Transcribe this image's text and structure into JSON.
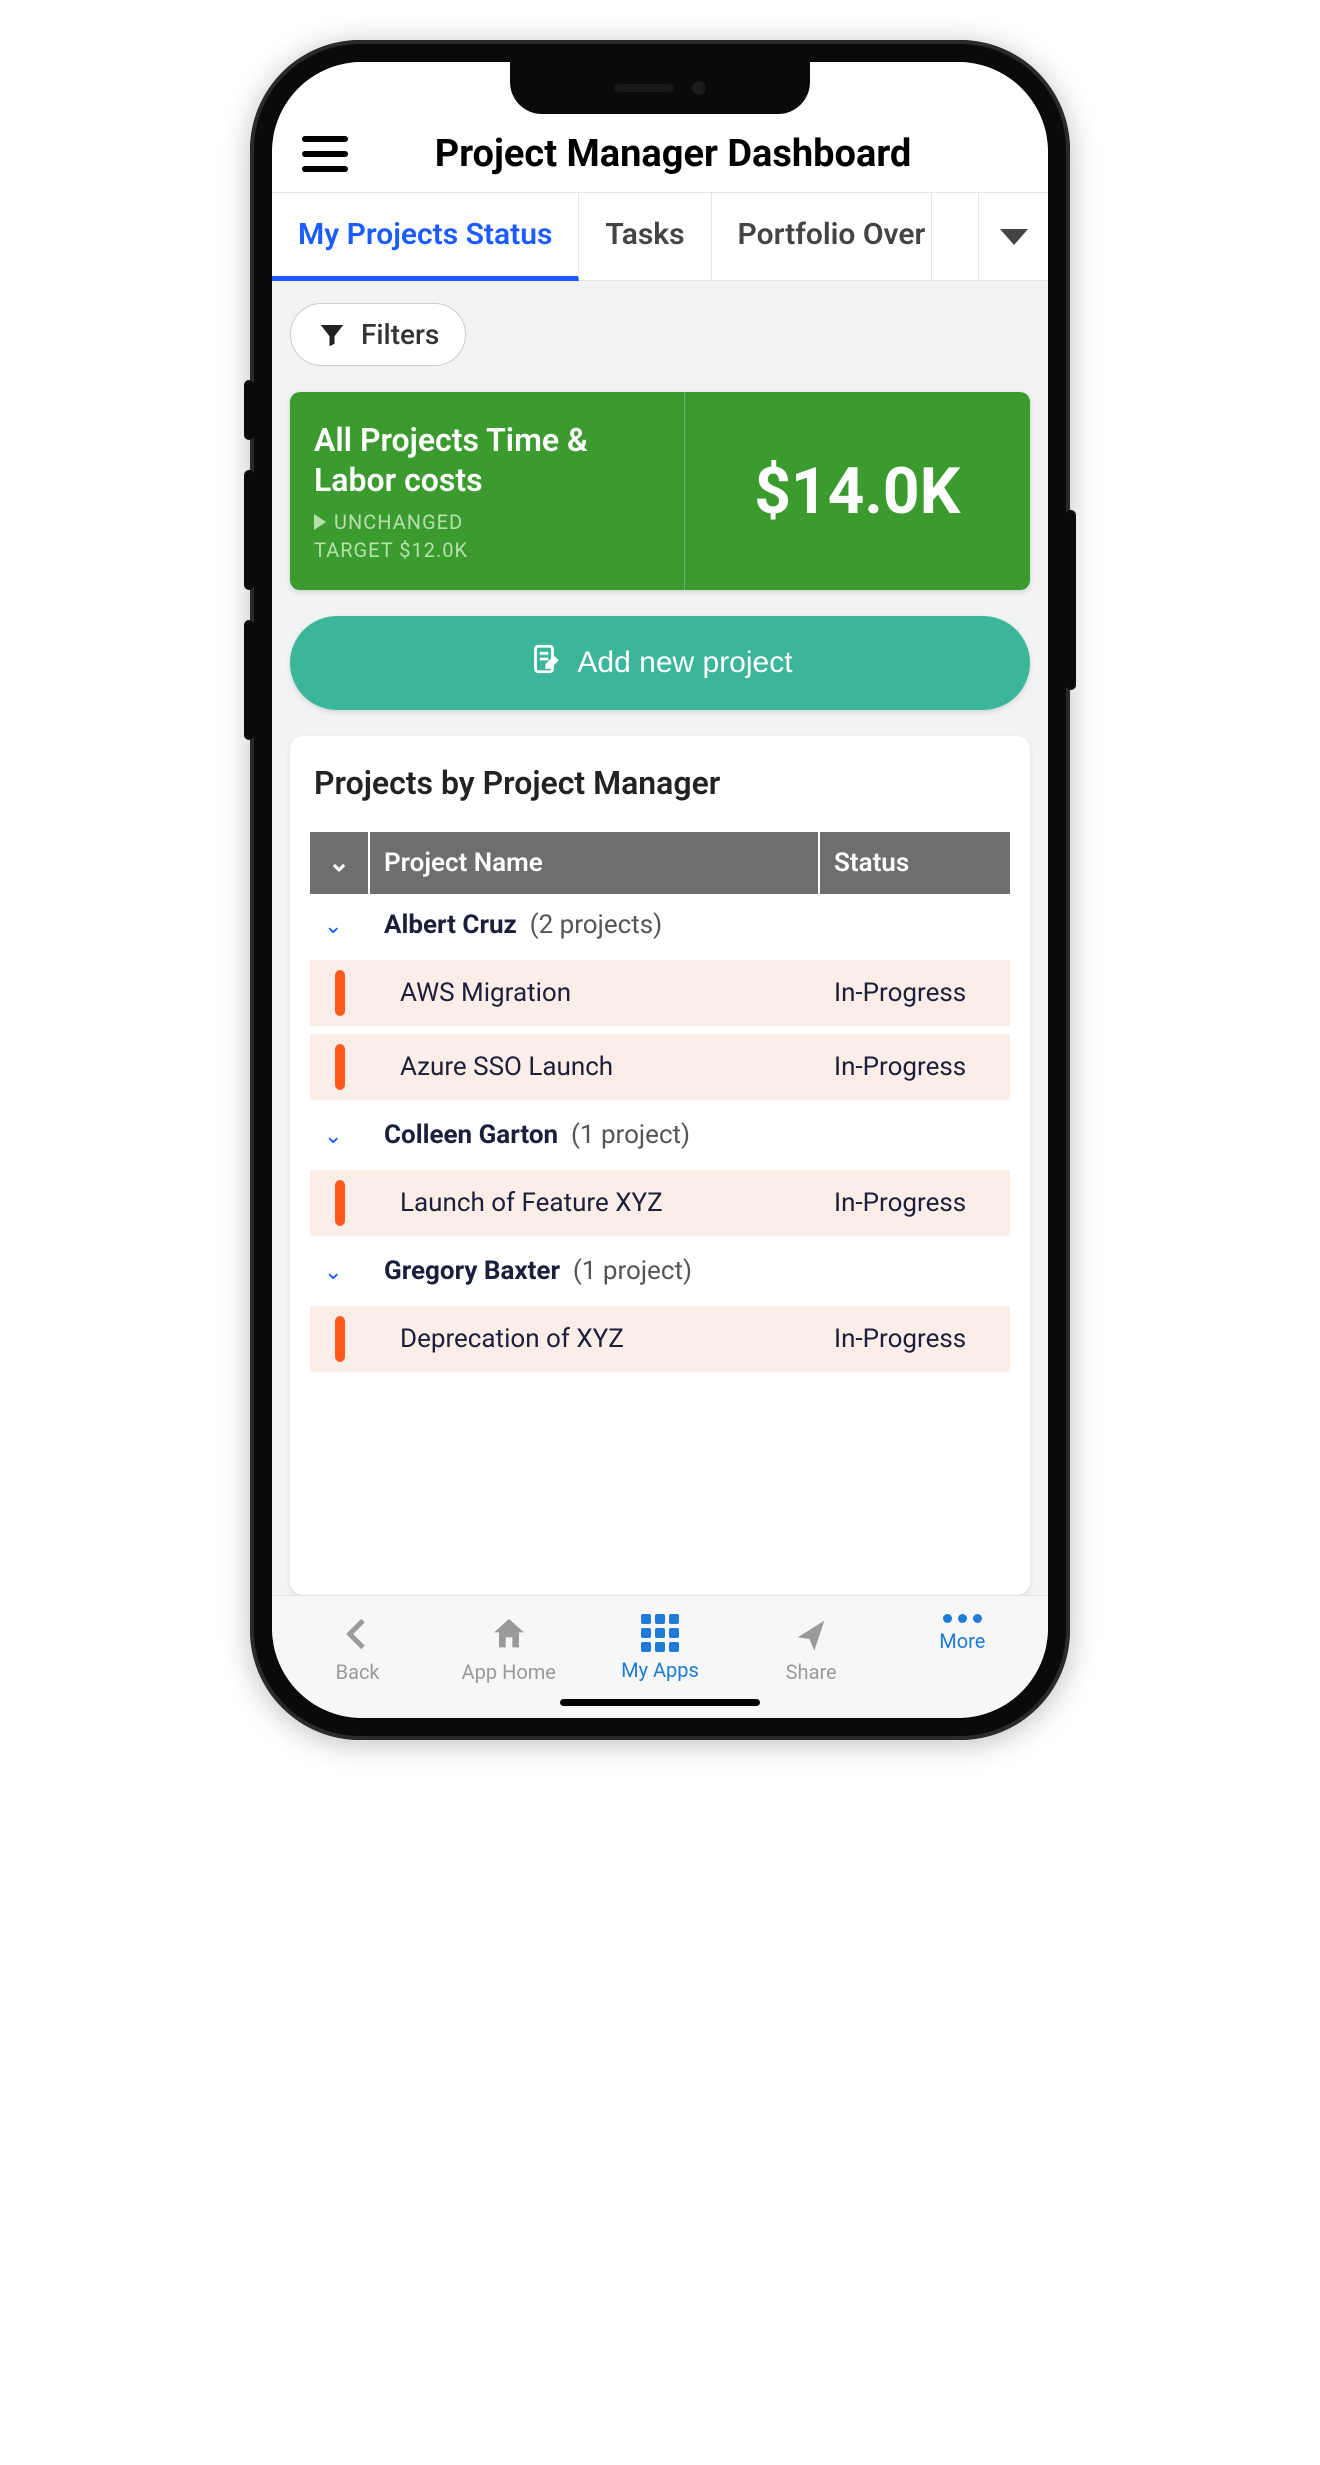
{
  "header": {
    "title": "Project Manager Dashboard"
  },
  "tabs": {
    "items": [
      "My Projects Status",
      "Tasks",
      "Portfolio Over"
    ],
    "active_index": 0
  },
  "filters": {
    "label": "Filters"
  },
  "kpi": {
    "title": "All Projects Time & Labor costs",
    "change_label": "UNCHANGED",
    "target_label": "TARGET $12.0K",
    "value": "$14.0K"
  },
  "add_project": {
    "label": "Add new project"
  },
  "projects_panel": {
    "title": "Projects by Project Manager",
    "columns": {
      "name": "Project Name",
      "status": "Status"
    },
    "groups": [
      {
        "manager": "Albert Cruz",
        "count_label": "(2 projects)",
        "rows": [
          {
            "name": "AWS Migration",
            "status": "In-Progress"
          },
          {
            "name": "Azure SSO Launch",
            "status": "In-Progress"
          }
        ]
      },
      {
        "manager": "Colleen Garton",
        "count_label": "(1 project)",
        "rows": [
          {
            "name": "Launch of Feature XYZ",
            "status": "In-Progress"
          }
        ]
      },
      {
        "manager": "Gregory Baxter",
        "count_label": "(1 project)",
        "rows": [
          {
            "name": "Deprecation of XYZ",
            "status": "In-Progress"
          }
        ]
      }
    ]
  },
  "bottom_nav": {
    "items": [
      {
        "label": "Back"
      },
      {
        "label": "App Home"
      },
      {
        "label": "My Apps"
      },
      {
        "label": "Share"
      },
      {
        "label": "More"
      }
    ],
    "active_index": 2
  }
}
